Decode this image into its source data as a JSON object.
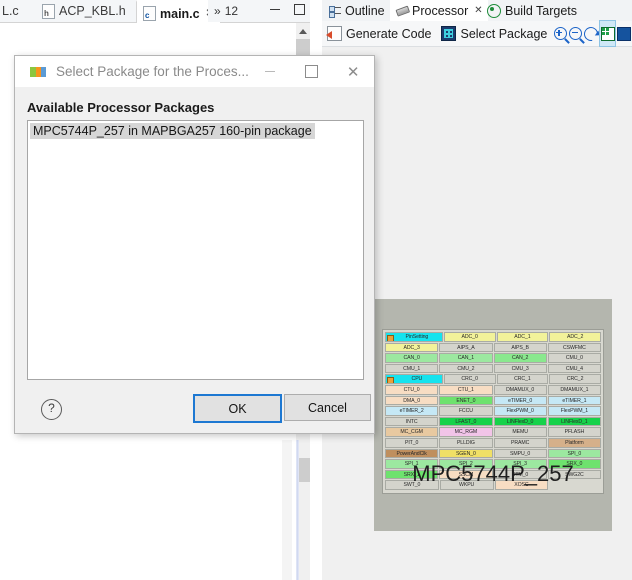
{
  "editor": {
    "tabs": [
      {
        "label": "L.c",
        "icon": "c-file-icon",
        "active": false
      },
      {
        "label": "ACP_KBL.h",
        "icon": "h-file-icon",
        "active": false
      },
      {
        "label": "main.c",
        "icon": "c-file-icon",
        "active": true
      }
    ],
    "overflow_label": "12",
    "overflow_prefix": "»",
    "close_glyph": "✕",
    "window_buttons": [
      "minimize",
      "maximize"
    ]
  },
  "processor_view": {
    "tabs": [
      {
        "label": "Outline",
        "icon": "outline-icon",
        "active": false
      },
      {
        "label": "Processor",
        "icon": "processor-icon",
        "active": true,
        "close": "✕"
      },
      {
        "label": "Build Targets",
        "icon": "build-targets-icon",
        "active": false
      }
    ],
    "toolbar": {
      "generate_code_label": "Generate Code",
      "select_package_label": "Select Package",
      "icons": [
        "zoom-in-icon",
        "zoom-out-icon",
        "refresh-icon",
        "grid-view-icon",
        "package-view-icon"
      ]
    },
    "chip": {
      "label": "MPC5744P_257",
      "rows": [
        [
          {
            "text": "PinSetting",
            "color": "#16e3ee",
            "icon": true
          },
          {
            "text": "ADC_0",
            "color": "#f2f29a"
          },
          {
            "text": "ADC_1",
            "color": "#f2f29a"
          },
          {
            "text": "ADC_2",
            "color": "#f2f29a"
          }
        ],
        [
          {
            "text": "ADC_3",
            "color": "#f2f29a"
          },
          {
            "text": "AIPS_A",
            "color": "#d4d4cc"
          },
          {
            "text": "AIPS_B",
            "color": "#d4d4cc"
          },
          {
            "text": "CSWFMC",
            "color": "#d4d4cc"
          }
        ],
        [
          {
            "text": "CAN_0",
            "color": "#9ce8a0"
          },
          {
            "text": "CAN_1",
            "color": "#9ce8a0"
          },
          {
            "text": "CAN_2",
            "color": "#8ae88e"
          },
          {
            "text": "CMU_0",
            "color": "#d4d4cc"
          }
        ],
        [
          {
            "text": "CMU_1",
            "color": "#d4d4cc"
          },
          {
            "text": "CMU_2",
            "color": "#d4d4cc"
          },
          {
            "text": "CMU_3",
            "color": "#d4d4cc"
          },
          {
            "text": "CMU_4",
            "color": "#d4d4cc"
          }
        ],
        [
          {
            "text": "CPU",
            "color": "#16e3ee",
            "icon": true
          },
          {
            "text": "CRC_0",
            "color": "#d4d4cc"
          },
          {
            "text": "CRC_1",
            "color": "#d4d4cc"
          },
          {
            "text": "CRC_2",
            "color": "#d4d4cc"
          }
        ],
        [
          {
            "text": "CTU_0",
            "color": "#f7ddc3"
          },
          {
            "text": "CTU_1",
            "color": "#f7ddc3"
          },
          {
            "text": "DMAMUX_0",
            "color": "#d4d4cc"
          },
          {
            "text": "DMAMUX_1",
            "color": "#d4d4cc"
          }
        ],
        [
          {
            "text": "DMA_0",
            "color": "#f7ddc3"
          },
          {
            "text": "ENET_0",
            "color": "#6ee26e"
          },
          {
            "text": "eTIMER_0",
            "color": "#c5e8f5"
          },
          {
            "text": "eTIMER_1",
            "color": "#c5e8f5"
          }
        ],
        [
          {
            "text": "eTIMER_2",
            "color": "#c5e8f5"
          },
          {
            "text": "FCCU",
            "color": "#d4d4cc"
          },
          {
            "text": "FlexPWM_0",
            "color": "#c5e8f5"
          },
          {
            "text": "FlexPWM_1",
            "color": "#c5e8f5"
          }
        ],
        [
          {
            "text": "INTC",
            "color": "#d4d4cc"
          },
          {
            "text": "LFAST_0",
            "color": "#16d24a"
          },
          {
            "text": "LINFlexD_0",
            "color": "#16d24a"
          },
          {
            "text": "LINFlexD_1",
            "color": "#16d24a"
          }
        ],
        [
          {
            "text": "MC_CGM",
            "color": "#e8c9a0"
          },
          {
            "text": "MC_RGM",
            "color": "#f2c4e8"
          },
          {
            "text": "MEMU",
            "color": "#d4d4cc"
          },
          {
            "text": "PFLASH",
            "color": "#d4d4cc"
          }
        ],
        [
          {
            "text": "PIT_0",
            "color": "#d4d4cc"
          },
          {
            "text": "PLLDIG",
            "color": "#d4d4cc"
          },
          {
            "text": "PRAMC",
            "color": "#d4d4cc"
          },
          {
            "text": "Platform",
            "color": "#d5b08a"
          }
        ],
        [
          {
            "text": "PowerAndClk",
            "color": "#bf8f5e"
          },
          {
            "text": "SGEN_0",
            "color": "#f0e066"
          },
          {
            "text": "SMPU_0",
            "color": "#d4d4cc"
          },
          {
            "text": "SPI_0",
            "color": "#9ce8a0"
          }
        ],
        [
          {
            "text": "SPI_1",
            "color": "#9ce8a0"
          },
          {
            "text": "SPI_2",
            "color": "#9ce8a0"
          },
          {
            "text": "SPI_3",
            "color": "#9ce8a0"
          },
          {
            "text": "SRX_0",
            "color": "#6ee26e"
          }
        ],
        [
          {
            "text": "SRX_1",
            "color": "#6ee26e"
          },
          {
            "text": "SSCM",
            "color": "#f7ddc3"
          },
          {
            "text": "STM_0",
            "color": "#d4d4cc"
          },
          {
            "text": "SWG2C",
            "color": "#d4d4cc"
          }
        ],
        [
          {
            "text": "SWT_0",
            "color": "#d4d4cc"
          },
          {
            "text": "WKPU",
            "color": "#d4d4cc"
          },
          {
            "text": "XOSC",
            "color": "#f7ddc3"
          },
          {
            "text": "",
            "color": "transparent",
            "empty": true
          }
        ]
      ]
    }
  },
  "dialog": {
    "title": "Select Package for the Proces...",
    "logo": "nxp-logo",
    "minimize_glyph": "",
    "maximize_glyph": "",
    "close_glyph": "✕",
    "heading": "Available Processor Packages",
    "packages": [
      {
        "label": "MPC5744P_257 in MAPBGA257 160-pin package",
        "selected": true
      }
    ],
    "help_glyph": "?",
    "ok_label": "OK",
    "cancel_label": "Cancel"
  }
}
